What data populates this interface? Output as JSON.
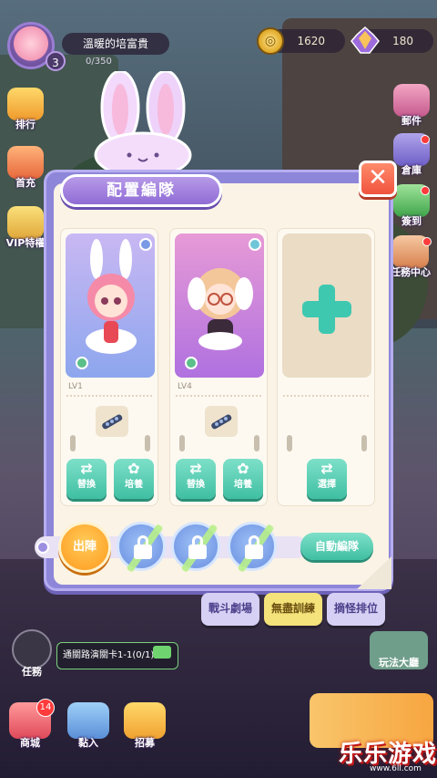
{
  "profile": {
    "name": "溫暖的培富貴",
    "level": "3",
    "exp": "0/350"
  },
  "currency": {
    "coins": "1620",
    "gems": "180"
  },
  "left_menu": [
    {
      "label": "排行"
    },
    {
      "label": "首充"
    },
    {
      "label": "VIP特權"
    }
  ],
  "right_menu": [
    {
      "label": "郵件"
    },
    {
      "label": "倉庫"
    },
    {
      "label": "簽到"
    },
    {
      "label": "任務中心"
    }
  ],
  "modal": {
    "title": "配置編隊",
    "close_symbol": "✕",
    "slots": [
      {
        "level": "LV1",
        "swap_label": "替換",
        "train_label": "培養"
      },
      {
        "level": "LV4",
        "swap_label": "替換",
        "train_label": "培養"
      },
      {
        "select_label": "選擇"
      }
    ],
    "deploy_label": "出陣",
    "auto_label": "自動編隊"
  },
  "tabs": [
    {
      "label": "戰斗劇場",
      "color": "#d6d0f4"
    },
    {
      "label": "無盡訓練",
      "color": "#f4e27a"
    },
    {
      "label": "摘怪排位",
      "color": "#d6d0f4"
    }
  ],
  "quest": {
    "text": "通關路演關卡1-1(0/1)",
    "task_label": "任務"
  },
  "bottom_menu": [
    {
      "label": "商城",
      "badge": "14"
    },
    {
      "label": "黏入"
    },
    {
      "label": "招募"
    }
  ],
  "play_guide": "玩法大廳",
  "watermark": {
    "title": "乐乐游戏",
    "url": "www.6ll.com"
  }
}
